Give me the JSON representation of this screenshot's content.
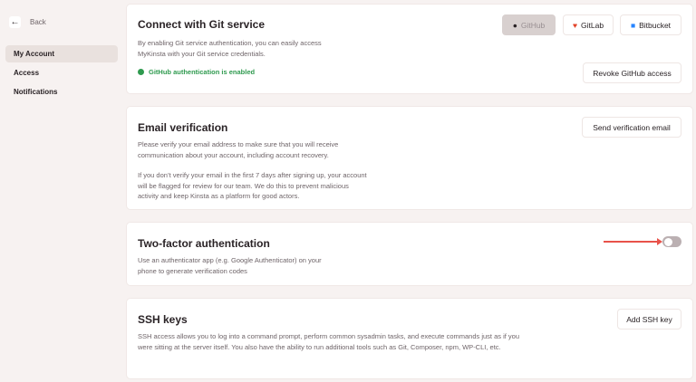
{
  "sidebar": {
    "back": "Back",
    "items": [
      {
        "label": "My Account",
        "active": true
      },
      {
        "label": "Access"
      },
      {
        "label": "Notifications"
      }
    ]
  },
  "git": {
    "title": "Connect with Git service",
    "desc": "By enabling Git service authentication, you can easily access MyKinsta with your Git service credentials.",
    "providers": [
      {
        "label": "GitHub",
        "icon": "github-icon",
        "selected": true
      },
      {
        "label": "GitLab",
        "icon": "gitlab-icon",
        "color": "#e24329"
      },
      {
        "label": "Bitbucket",
        "icon": "bitbucket-icon",
        "color": "#2684ff"
      }
    ],
    "status": "GitHub authentication is enabled",
    "status_color": "#2f9a4f",
    "revoke": "Revoke GitHub access"
  },
  "email": {
    "title": "Email verification",
    "desc1": "Please verify your email address to make sure that you will receive communication about your account, including account recovery.",
    "desc2": "If you don’t verify your email in the first 7 days after signing up, your account will be flagged for review for our team. We do this to prevent malicious activity and keep Kinsta as a platform for good actors.",
    "button": "Send verification email"
  },
  "twofa": {
    "title": "Two-factor authentication",
    "desc": "Use an authenticator app (e.g. Google Authenticator) on your phone to generate verification codes",
    "enabled": false
  },
  "ssh": {
    "title": "SSH keys",
    "desc": "SSH access allows you to log into a command prompt, perform common sysadmin tasks, and execute commands just as if you were sitting at the server itself. You also have the ability to run additional tools such as Git, Composer, npm, WP-CLI, etc.",
    "button": "Add SSH key"
  }
}
